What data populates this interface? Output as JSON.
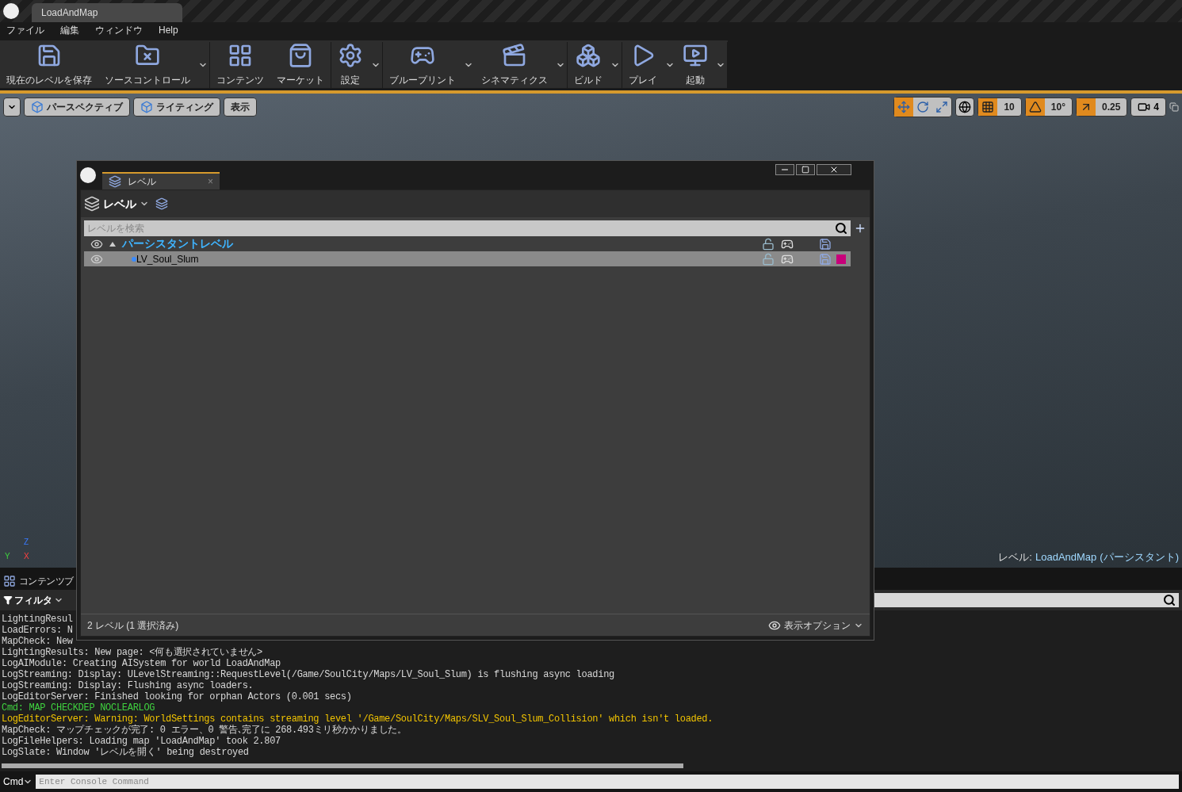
{
  "app_tab": {
    "title": "LoadAndMap"
  },
  "menu": [
    "ファイル",
    "編集",
    "ウィンドウ",
    "Help"
  ],
  "toolbar_groups": [
    [
      {
        "label": "現在のレベルを保存",
        "kind": "save",
        "has_menu": false
      },
      {
        "label": "ソースコントロール",
        "kind": "source",
        "has_menu": true
      }
    ],
    [
      {
        "label": "コンテンツ",
        "kind": "content",
        "has_menu": false
      },
      {
        "label": "マーケット",
        "kind": "market",
        "has_menu": false
      }
    ],
    [
      {
        "label": "設定",
        "kind": "settings",
        "has_menu": true
      }
    ],
    [
      {
        "label": "ブループリント",
        "kind": "blueprint",
        "has_menu": true
      },
      {
        "label": "シネマティクス",
        "kind": "cinematics",
        "has_menu": true
      }
    ],
    [
      {
        "label": "ビルド",
        "kind": "build",
        "has_menu": true
      }
    ],
    [
      {
        "label": "プレイ",
        "kind": "play",
        "has_menu": true
      },
      {
        "label": "起動",
        "kind": "launch",
        "has_menu": true
      }
    ]
  ],
  "viewport": {
    "buttons": [
      {
        "label": "パースペクティブ",
        "kind": "perspective"
      },
      {
        "label": "ライティング",
        "kind": "lighting"
      },
      {
        "label": "表示",
        "kind": "show"
      }
    ],
    "transform_modes": [
      {
        "kind": "move",
        "selected": true
      },
      {
        "kind": "rotate",
        "selected": false
      },
      {
        "kind": "scale",
        "selected": false
      }
    ],
    "snaps": [
      {
        "kind": "grid",
        "value": "10",
        "on": true
      },
      {
        "kind": "rotation",
        "value": "10°",
        "on": true
      },
      {
        "kind": "scale",
        "value": "0.25",
        "on": true
      }
    ],
    "camera_speed": "4",
    "axis_labels": [
      "Z",
      "Y",
      "X"
    ],
    "level_caption": "レベル:",
    "level_name": "LoadAndMap",
    "level_suffix": "(パーシスタント)"
  },
  "content_browser": {
    "tab": "コンテンツブ",
    "filter": "フィルタ"
  },
  "log": [
    {
      "text": "LightingResul",
      "kind": "normal"
    },
    {
      "text": "LoadErrors: N",
      "kind": "normal"
    },
    {
      "text": "MapCheck: New",
      "kind": "normal"
    },
    {
      "text": "LightingResults: New page: <何も選択されていません>",
      "kind": "normal"
    },
    {
      "text": "LogAIModule: Creating AISystem for world LoadAndMap",
      "kind": "normal"
    },
    {
      "text": "LogStreaming: Display: ULevelStreaming::RequestLevel(/Game/SoulCity/Maps/LV_Soul_Slum) is flushing async loading",
      "kind": "normal"
    },
    {
      "text": "LogStreaming: Display: Flushing async loaders.",
      "kind": "normal"
    },
    {
      "text": "LogEditorServer: Finished looking for orphan Actors (0.001 secs)",
      "kind": "normal"
    },
    {
      "text": "Cmd: MAP CHECKDEP NOCLEARLOG",
      "kind": "command"
    },
    {
      "text": "LogEditorServer: Warning: WorldSettings contains streaming level '/Game/SoulCity/Maps/SLV_Soul_Slum_Collision' which isn't loaded.",
      "kind": "warning"
    },
    {
      "text": "MapCheck: マップチェックが完了: 0 エラー、0 警告､完了に 268.493ミリ秒かかりました。",
      "kind": "normal"
    },
    {
      "text": "LogFileHelpers: Loading map 'LoadAndMap' took 2.807",
      "kind": "normal"
    },
    {
      "text": "LogSlate: Window 'レベルを開く' being destroyed",
      "kind": "normal"
    }
  ],
  "console": {
    "label": "Cmd",
    "placeholder": "Enter Console Command"
  },
  "levels_window": {
    "tab": "レベル",
    "tab_close": "×",
    "menu": "レベル",
    "search_placeholder": "レベルを検索",
    "rows": [
      {
        "name": "パーシスタントレベル",
        "kind": "persistent",
        "expanded": true,
        "selected": false,
        "visible": true
      },
      {
        "name": "LV_Soul_Slum",
        "kind": "streaming",
        "selected": true,
        "visible": true,
        "color": "#c8007a"
      }
    ],
    "footer": "2 レベル (1 選択済み)",
    "view_options": "表示オプション"
  }
}
